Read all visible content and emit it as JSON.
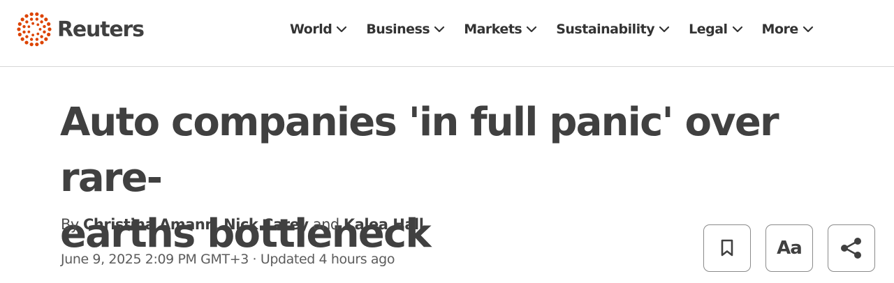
{
  "header": {
    "logo_text": "Reuters",
    "brand_color": "#dc4300",
    "nav": [
      {
        "label": "World",
        "icon": "chevron-down-icon"
      },
      {
        "label": "Business",
        "icon": "chevron-down-icon"
      },
      {
        "label": "Markets",
        "icon": "chevron-down-icon"
      },
      {
        "label": "Sustainability",
        "icon": "chevron-down-icon"
      },
      {
        "label": "Legal",
        "icon": "chevron-down-icon"
      },
      {
        "label": "More",
        "icon": "chevron-down-icon"
      }
    ]
  },
  "article": {
    "headline_line1": "Auto companies 'in full panic' over rare-",
    "headline_line2": "earths bottleneck",
    "byline": {
      "prefix": "By ",
      "authors": [
        "Christina Amann",
        "Nick Carey",
        "Kalea Hall"
      ],
      "separator": ", ",
      "conjunction": " and "
    },
    "dateline": "June 9, 2025 2:09 PM GMT+3 · Updated 4 hours ago"
  },
  "actions": {
    "bookmark_icon": "bookmark-icon",
    "font_size_label": "Aa",
    "share_icon": "share-icon"
  }
}
